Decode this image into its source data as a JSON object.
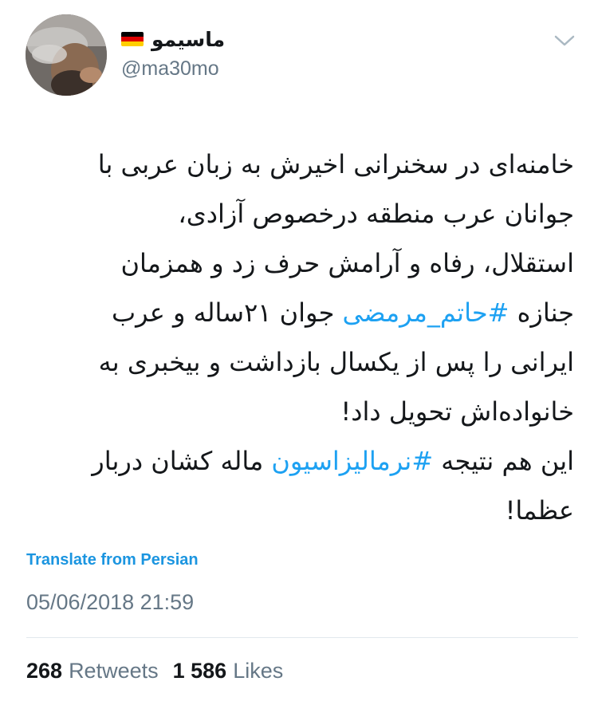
{
  "user": {
    "display_name": "ماسیمو",
    "handle": "@ma30mo",
    "flag_colors": [
      "#000000",
      "#dd0000",
      "#ffce00"
    ]
  },
  "tweet": {
    "lines": [
      [
        {
          "text": "خامنه‌ای در سخنرانی اخیرش به زبان عربی با",
          "hashtag": false
        }
      ],
      [
        {
          "text": "جوانان عرب منطقه درخصوص آزادی،",
          "hashtag": false
        }
      ],
      [
        {
          "text": "استقلال، رفاه و آرامش حرف زد و همزمان",
          "hashtag": false
        }
      ],
      [
        {
          "text": "جنازه ",
          "hashtag": false
        },
        {
          "text": "#حاتم_مرمضی",
          "hashtag": true
        },
        {
          "text": " جوان ۲۱ساله و عرب",
          "hashtag": false
        }
      ],
      [
        {
          "text": "ایرانی را پس از یکسال بازداشت و بیخبری به",
          "hashtag": false
        }
      ],
      [
        {
          "text": "خانواده‌اش تحویل داد!",
          "hashtag": false
        }
      ],
      [
        {
          "text": "این هم نتیجه ",
          "hashtag": false
        },
        {
          "text": "#نرمالیزاسیون",
          "hashtag": true
        },
        {
          "text": " ماله کشان دربار",
          "hashtag": false
        }
      ],
      [
        {
          "text": "عظما!",
          "hashtag": false
        }
      ]
    ]
  },
  "translate_label": "Translate from Persian",
  "timestamp": "05/06/2018 21:59",
  "stats": {
    "retweets_count": "268",
    "retweets_label": "Retweets",
    "likes_count": "1 586",
    "likes_label": "Likes"
  },
  "colors": {
    "hashtag": "#1da1f2",
    "link": "#1b95e0",
    "secondary": "#657786"
  }
}
